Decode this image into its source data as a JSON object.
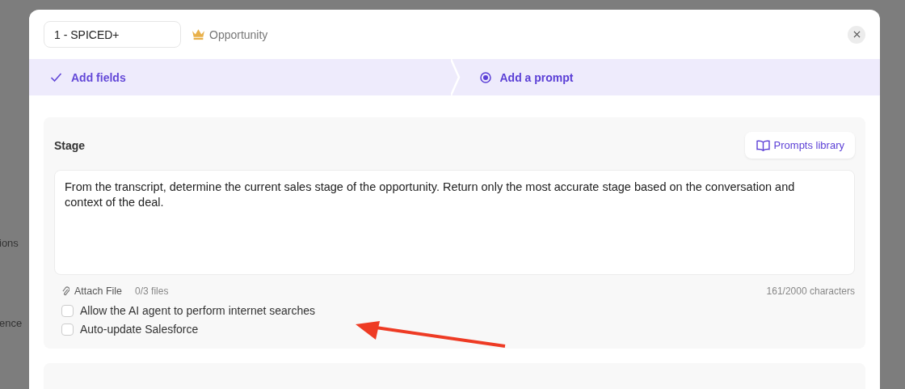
{
  "background": {
    "texts": [
      "ions",
      "ence"
    ]
  },
  "modal": {
    "name_value": "1 - SPICED+",
    "object_label": "Opportunity",
    "steps": [
      {
        "label": "Add fields",
        "selected": false
      },
      {
        "label": "Add a prompt",
        "selected": true
      }
    ],
    "field_card": {
      "title": "Stage",
      "library_button": "Prompts library",
      "prompt": "From the transcript, determine the current sales stage of the opportunity. Return only the most accurate stage based on the conversation and context of the deal.",
      "attach_label": "Attach File",
      "files_count": "0/3 files",
      "char_count": "161/2000 characters",
      "options": [
        {
          "label": "Allow the AI agent to perform internet searches",
          "checked": false
        },
        {
          "label": "Auto-update Salesforce",
          "checked": false
        }
      ]
    }
  }
}
